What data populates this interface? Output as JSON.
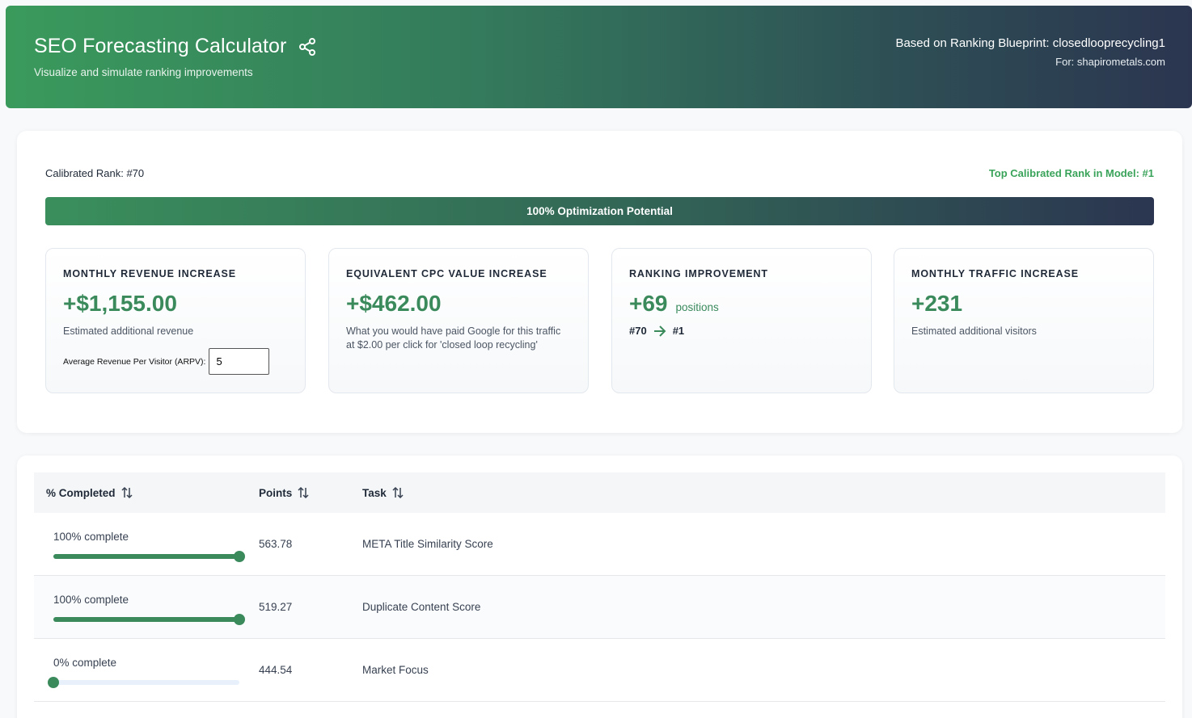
{
  "header": {
    "title": "SEO Forecasting Calculator",
    "subtitle": "Visualize and simulate ranking improvements",
    "blueprint": "Based on Ranking Blueprint: closedlooprecycling1",
    "for": "For: shapirometals.com"
  },
  "summary": {
    "calibrated_rank": "Calibrated Rank: #70",
    "top_rank": "Top Calibrated Rank in Model: #1",
    "optimization": "100% Optimization Potential",
    "revenue": {
      "label": "MONTHLY REVENUE INCREASE",
      "value": "+$1,155.00",
      "desc": "Estimated additional revenue",
      "arpv_label": "Average Revenue Per Visitor (ARPV):",
      "arpv_value": "5"
    },
    "cpc": {
      "label": "EQUIVALENT CPC VALUE INCREASE",
      "value": "+$462.00",
      "desc": "What you would have paid Google for this traffic at $2.00 per click for 'closed loop recycling'"
    },
    "ranking": {
      "label": "RANKING IMPROVEMENT",
      "value": "+69",
      "unit": "positions",
      "from": "#70",
      "to": "#1"
    },
    "traffic": {
      "label": "MONTHLY TRAFFIC INCREASE",
      "value": "+231",
      "desc": "Estimated additional visitors"
    }
  },
  "table": {
    "headers": [
      "% Completed",
      "Points",
      "Task"
    ],
    "rows": [
      {
        "progress_label": "100% complete",
        "progress": 100,
        "points": "563.78",
        "task": "META Title Similarity Score"
      },
      {
        "progress_label": "100% complete",
        "progress": 100,
        "points": "519.27",
        "task": "Duplicate Content Score"
      },
      {
        "progress_label": "0% complete",
        "progress": 0,
        "points": "444.54",
        "task": "Market Focus"
      }
    ]
  },
  "colors": {
    "accent": "#3a8a5c",
    "header_start": "#3a9a5c",
    "header_end": "#2b3550",
    "track": "#e8f1fb"
  },
  "icons": {
    "share": "share-icon",
    "sort": "sort-arrows-icon",
    "arrow": "arrow-right-icon"
  }
}
